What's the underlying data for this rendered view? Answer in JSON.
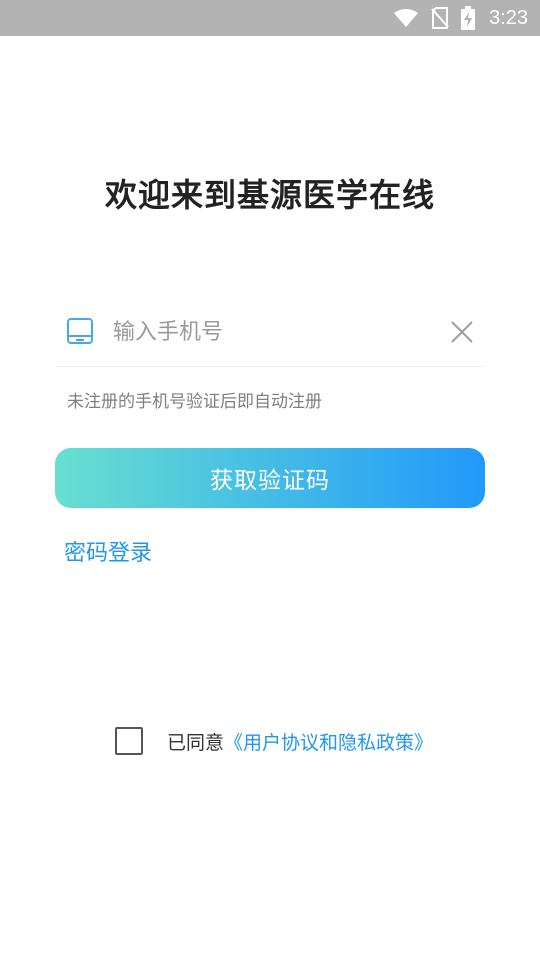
{
  "status_bar": {
    "time": "3:23",
    "icons": [
      "wifi-icon",
      "no-sim-icon",
      "battery-charging-icon"
    ]
  },
  "title": "欢迎来到基源医学在线",
  "phone": {
    "placeholder": "输入手机号",
    "value": "",
    "icon": "phone-icon",
    "clear_icon": "close-icon"
  },
  "hint": "未注册的手机号验证后即自动注册",
  "get_code_label": "获取验证码",
  "password_login_label": "密码登录",
  "agreement": {
    "checked": false,
    "prefix": "已同意",
    "link": "《用户协议和隐私政策》"
  },
  "colors": {
    "accent": "#2196f3",
    "gradient_start": "#67dfd0",
    "gradient_end": "#2199fb",
    "status_bar": "#b3b3b3"
  }
}
